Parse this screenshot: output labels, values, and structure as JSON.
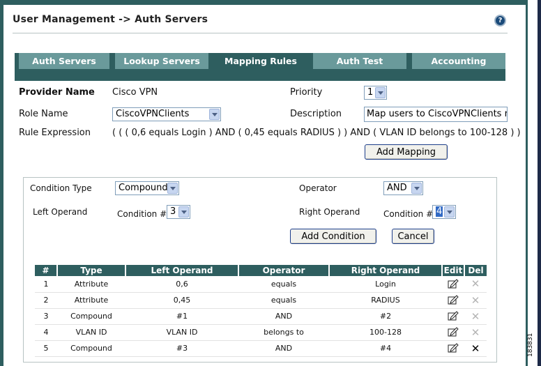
{
  "page": {
    "title": "User Management -> Auth Servers",
    "help_icon": "help-icon",
    "side_label": "183831"
  },
  "tabs": [
    {
      "label": "Auth Servers",
      "active": false
    },
    {
      "label": "Lookup Servers",
      "active": false
    },
    {
      "label": "Mapping Rules",
      "active": true
    },
    {
      "label": "Auth Test",
      "active": false
    },
    {
      "label": "Accounting",
      "active": false
    }
  ],
  "form": {
    "provider_name_label": "Provider Name",
    "provider_name_value": "Cisco VPN",
    "priority_label": "Priority",
    "priority_value": "1",
    "role_name_label": "Role Name",
    "role_name_value": "CiscoVPNClients",
    "description_label": "Description",
    "description_value": "Map users to CiscoVPNClients rol",
    "rule_expression_label": "Rule Expression",
    "rule_expression_value": "( ( ( 0,6 equals Login ) AND ( 0,45 equals RADIUS ) ) AND ( VLAN ID belongs to 100-128 ) )",
    "add_mapping_label": "Add Mapping"
  },
  "condition": {
    "type_label": "Condition Type",
    "type_value": "Compound",
    "operator_label": "Operator",
    "operator_value": "AND",
    "left_operand_label": "Left Operand",
    "left_condition_label": "Condition #",
    "left_condition_value": "3",
    "right_operand_label": "Right Operand",
    "right_condition_label": "Condition #",
    "right_condition_value": "4",
    "add_condition_label": "Add Condition",
    "cancel_label": "Cancel"
  },
  "table": {
    "headers": [
      "#",
      "Type",
      "Left Operand",
      "Operator",
      "Right Operand",
      "Edit",
      "Del"
    ],
    "rows": [
      {
        "num": "1",
        "type": "Attribute",
        "left": "0,6",
        "op": "equals",
        "right": "Login",
        "del_enabled": false
      },
      {
        "num": "2",
        "type": "Attribute",
        "left": "0,45",
        "op": "equals",
        "right": "RADIUS",
        "del_enabled": false
      },
      {
        "num": "3",
        "type": "Compound",
        "left": "#1",
        "op": "AND",
        "right": "#2",
        "del_enabled": false
      },
      {
        "num": "4",
        "type": "VLAN ID",
        "left": "VLAN ID",
        "op": "belongs to",
        "right": "100-128",
        "del_enabled": false
      },
      {
        "num": "5",
        "type": "Compound",
        "left": "#3",
        "op": "AND",
        "right": "#4",
        "del_enabled": true
      }
    ],
    "edit_icon": "edit-icon",
    "delete_icon": "delete-x-icon"
  },
  "colors": {
    "primary_teal": "#2e5e5f",
    "tab_inactive": "#6a9a9b",
    "panel_border": "#b7c3c3",
    "button_border": "#1c3d8a"
  }
}
